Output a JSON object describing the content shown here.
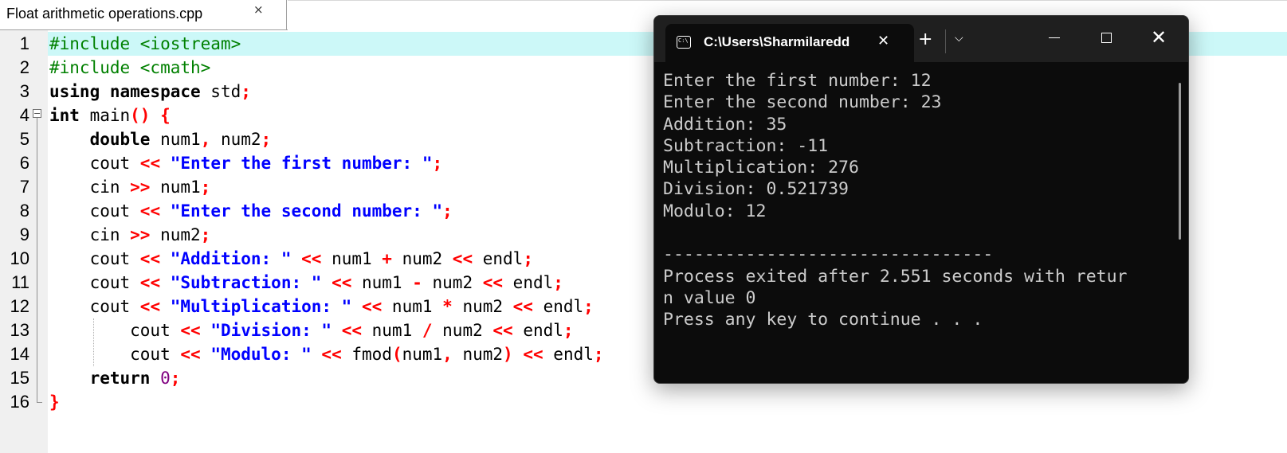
{
  "editor": {
    "tab_title": "Float arithmetic operations.cpp",
    "tab_close_icon": "×",
    "fold_icon": "−"
  },
  "lines": [
    {
      "n": "1",
      "parts": [
        {
          "t": "#include <iostream>",
          "c": "pp"
        }
      ]
    },
    {
      "n": "2",
      "parts": [
        {
          "t": "#include <cmath>",
          "c": "pp"
        }
      ]
    },
    {
      "n": "3",
      "parts": [
        {
          "t": "using namespace",
          "c": "kw"
        },
        {
          "t": " std",
          "c": ""
        },
        {
          "t": ";",
          "c": "op"
        }
      ]
    },
    {
      "n": "4",
      "parts": [
        {
          "t": "int",
          "c": "kw"
        },
        {
          "t": " main",
          "c": ""
        },
        {
          "t": "()",
          "c": "op"
        },
        {
          "t": " ",
          "c": ""
        },
        {
          "t": "{",
          "c": "op"
        }
      ]
    },
    {
      "n": "5",
      "parts": [
        {
          "t": "    ",
          "c": ""
        },
        {
          "t": "double",
          "c": "kw"
        },
        {
          "t": " num1",
          "c": ""
        },
        {
          "t": ",",
          "c": "op"
        },
        {
          "t": " num2",
          "c": ""
        },
        {
          "t": ";",
          "c": "op"
        }
      ]
    },
    {
      "n": "6",
      "parts": [
        {
          "t": "    cout ",
          "c": ""
        },
        {
          "t": "<<",
          "c": "op"
        },
        {
          "t": " ",
          "c": ""
        },
        {
          "t": "\"Enter the first number: \"",
          "c": "str"
        },
        {
          "t": ";",
          "c": "op"
        }
      ]
    },
    {
      "n": "7",
      "parts": [
        {
          "t": "    cin ",
          "c": ""
        },
        {
          "t": ">>",
          "c": "op"
        },
        {
          "t": " num1",
          "c": ""
        },
        {
          "t": ";",
          "c": "op"
        }
      ]
    },
    {
      "n": "8",
      "parts": [
        {
          "t": "    cout ",
          "c": ""
        },
        {
          "t": "<<",
          "c": "op"
        },
        {
          "t": " ",
          "c": ""
        },
        {
          "t": "\"Enter the second number: \"",
          "c": "str"
        },
        {
          "t": ";",
          "c": "op"
        }
      ]
    },
    {
      "n": "9",
      "parts": [
        {
          "t": "    cin ",
          "c": ""
        },
        {
          "t": ">>",
          "c": "op"
        },
        {
          "t": " num2",
          "c": ""
        },
        {
          "t": ";",
          "c": "op"
        }
      ]
    },
    {
      "n": "10",
      "parts": [
        {
          "t": "    cout ",
          "c": ""
        },
        {
          "t": "<<",
          "c": "op"
        },
        {
          "t": " ",
          "c": ""
        },
        {
          "t": "\"Addition: \"",
          "c": "str"
        },
        {
          "t": " ",
          "c": ""
        },
        {
          "t": "<<",
          "c": "op"
        },
        {
          "t": " num1 ",
          "c": ""
        },
        {
          "t": "+",
          "c": "op"
        },
        {
          "t": " num2 ",
          "c": ""
        },
        {
          "t": "<<",
          "c": "op"
        },
        {
          "t": " endl",
          "c": ""
        },
        {
          "t": ";",
          "c": "op"
        }
      ]
    },
    {
      "n": "11",
      "parts": [
        {
          "t": "    cout ",
          "c": ""
        },
        {
          "t": "<<",
          "c": "op"
        },
        {
          "t": " ",
          "c": ""
        },
        {
          "t": "\"Subtraction: \"",
          "c": "str"
        },
        {
          "t": " ",
          "c": ""
        },
        {
          "t": "<<",
          "c": "op"
        },
        {
          "t": " num1 ",
          "c": ""
        },
        {
          "t": "-",
          "c": "op"
        },
        {
          "t": " num2 ",
          "c": ""
        },
        {
          "t": "<<",
          "c": "op"
        },
        {
          "t": " endl",
          "c": ""
        },
        {
          "t": ";",
          "c": "op"
        }
      ]
    },
    {
      "n": "12",
      "parts": [
        {
          "t": "    cout ",
          "c": ""
        },
        {
          "t": "<<",
          "c": "op"
        },
        {
          "t": " ",
          "c": ""
        },
        {
          "t": "\"Multiplication: \"",
          "c": "str"
        },
        {
          "t": " ",
          "c": ""
        },
        {
          "t": "<<",
          "c": "op"
        },
        {
          "t": " num1 ",
          "c": ""
        },
        {
          "t": "*",
          "c": "op"
        },
        {
          "t": " num2 ",
          "c": ""
        },
        {
          "t": "<<",
          "c": "op"
        },
        {
          "t": " endl",
          "c": ""
        },
        {
          "t": ";",
          "c": "op"
        }
      ]
    },
    {
      "n": "13",
      "parts": [
        {
          "t": "        cout ",
          "c": ""
        },
        {
          "t": "<<",
          "c": "op"
        },
        {
          "t": " ",
          "c": ""
        },
        {
          "t": "\"Division: \"",
          "c": "str"
        },
        {
          "t": " ",
          "c": ""
        },
        {
          "t": "<<",
          "c": "op"
        },
        {
          "t": " num1 ",
          "c": ""
        },
        {
          "t": "/",
          "c": "op"
        },
        {
          "t": " num2 ",
          "c": ""
        },
        {
          "t": "<<",
          "c": "op"
        },
        {
          "t": " endl",
          "c": ""
        },
        {
          "t": ";",
          "c": "op"
        }
      ]
    },
    {
      "n": "14",
      "parts": [
        {
          "t": "        cout ",
          "c": ""
        },
        {
          "t": "<<",
          "c": "op"
        },
        {
          "t": " ",
          "c": ""
        },
        {
          "t": "\"Modulo: \"",
          "c": "str"
        },
        {
          "t": " ",
          "c": ""
        },
        {
          "t": "<<",
          "c": "op"
        },
        {
          "t": " fmod",
          "c": ""
        },
        {
          "t": "(",
          "c": "op"
        },
        {
          "t": "num1",
          "c": ""
        },
        {
          "t": ",",
          "c": "op"
        },
        {
          "t": " num2",
          "c": ""
        },
        {
          "t": ")",
          "c": "op"
        },
        {
          "t": " ",
          "c": ""
        },
        {
          "t": "<<",
          "c": "op"
        },
        {
          "t": " endl",
          "c": ""
        },
        {
          "t": ";",
          "c": "op"
        }
      ]
    },
    {
      "n": "15",
      "parts": [
        {
          "t": "    ",
          "c": ""
        },
        {
          "t": "return",
          "c": "kw"
        },
        {
          "t": " ",
          "c": ""
        },
        {
          "t": "0",
          "c": "num"
        },
        {
          "t": ";",
          "c": "op"
        }
      ]
    },
    {
      "n": "16",
      "parts": [
        {
          "t": "}",
          "c": "op"
        }
      ]
    }
  ],
  "terminal": {
    "tab_title": "C:\\Users\\Sharmilaredd",
    "icon_text": "C:\\",
    "close_tab_glyph": "✕",
    "new_tab_glyph": "+",
    "dropdown_glyph": "⌵",
    "close_window_glyph": "✕",
    "output": [
      "Enter the first number: 12",
      "Enter the second number: 23",
      "Addition: 35",
      "Subtraction: -11",
      "Multiplication: 276",
      "Division: 0.521739",
      "Modulo: 12",
      "",
      "--------------------------------",
      "Process exited after 2.551 seconds with retur",
      "n value 0",
      "Press any key to continue . . ."
    ]
  },
  "colors": {
    "current_line": "#ccf8f8",
    "keyword": "#000000",
    "preprocessor": "#008000",
    "string": "#0000ff",
    "operator": "#ff0000",
    "number": "#800080",
    "terminal_bg": "#0c0c0c",
    "terminal_text": "#cccccc"
  }
}
